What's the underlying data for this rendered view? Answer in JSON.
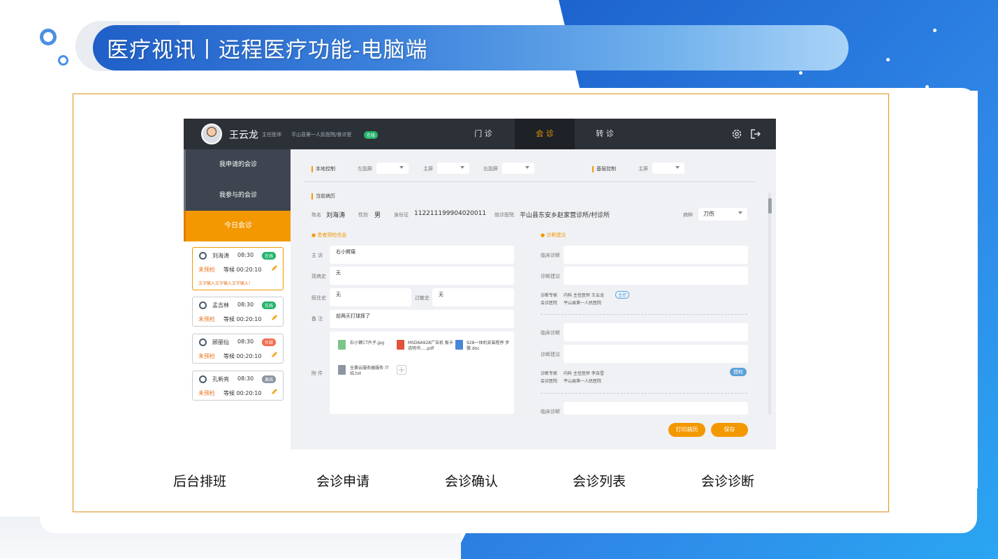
{
  "slide_title": "医疗视讯丨远程医疗功能-电脑端",
  "colors": {
    "accent": "#f39800",
    "blue_dark": "#1f5fc8",
    "online_green": "#24b36b",
    "emergency_red": "#f26d4f",
    "timeout_gray": "#8c96a2"
  },
  "app": {
    "user": {
      "name": "王云龙",
      "role": "主任医师",
      "hospital": "平山县第一人民医院/普诊室",
      "status": "在线"
    },
    "nav": [
      "门 诊",
      "会 诊",
      "转 诊"
    ],
    "sidebar_tabs": [
      "我申请的会诊",
      "我参与的会诊",
      "今日会诊"
    ],
    "patients": [
      {
        "name": "刘海涛",
        "time": "08:30",
        "badge": "在线",
        "status": "未预检",
        "wait": "等候 00:20:10",
        "note": "文字输入文字输入文字输入！"
      },
      {
        "name": "孟吉林",
        "time": "08:30",
        "badge": "在线",
        "status": "未预检",
        "wait": "等候 00:20:10",
        "note": ""
      },
      {
        "name": "顾丽仙",
        "time": "08:30",
        "badge": "忙碌",
        "status": "未预检",
        "wait": "等候 00:20:10",
        "note": ""
      },
      {
        "name": "孔新亮",
        "time": "08:30",
        "badge": "离线",
        "status": "未预检",
        "wait": "等候 00:20:10",
        "note": ""
      }
    ],
    "controls": {
      "local": "本地控制",
      "left_screen": "左副屏",
      "main_screen": "主屏",
      "right_screen": "右副屏",
      "base": "基层控制",
      "base_main": "主屏"
    },
    "record": {
      "title": "当前病历",
      "name_label": "姓名",
      "name": "刘海涛",
      "gender_label": "性别",
      "gender": "男",
      "id_label": "身份证",
      "id": "112211199904020011",
      "clinic_label": "就诊医院",
      "clinic": "平山县东安乡赵家营诊所/村诊所",
      "disease_label": "病种",
      "disease": "刀伤"
    },
    "precheck": {
      "title": "● 患者预检信息",
      "complaint_label": "主 诉",
      "complaint": "右小臂痛",
      "present_label": "现病史",
      "present": "无",
      "past_label": "既往史",
      "past": "无",
      "allergy_label": "过敏史",
      "allergy": "无",
      "remark_label": "备 注",
      "remark": "前两天打球摔了",
      "attach_label": "附 件",
      "files": [
        "右小臂CT片子.jpg",
        "MSD6A928广告机 板卡说明书.....pdf",
        "928一体机安装程序 步骤.doc",
        "全寰云服务器服务 介绍.txt"
      ]
    },
    "diagnosis": {
      "title": "● 诊断建议",
      "clinical_label": "临床诊断",
      "advice_label": "诊断建议",
      "expert_label": "诊断专家",
      "hospital_label": "会诊医院",
      "expert1": "内科 主任医师 王云龙",
      "tag1": "主控",
      "hospital1": "平山县第一人民医院",
      "expert2": "内科 主任医师 李自雪",
      "tag2": "授权",
      "hospital2": "平山县第一人民医院"
    },
    "buttons": {
      "print": "打印病历",
      "save": "保存"
    }
  },
  "captions": [
    "后台排班",
    "会诊申请",
    "会诊确认",
    "会诊列表",
    "会诊诊断"
  ]
}
